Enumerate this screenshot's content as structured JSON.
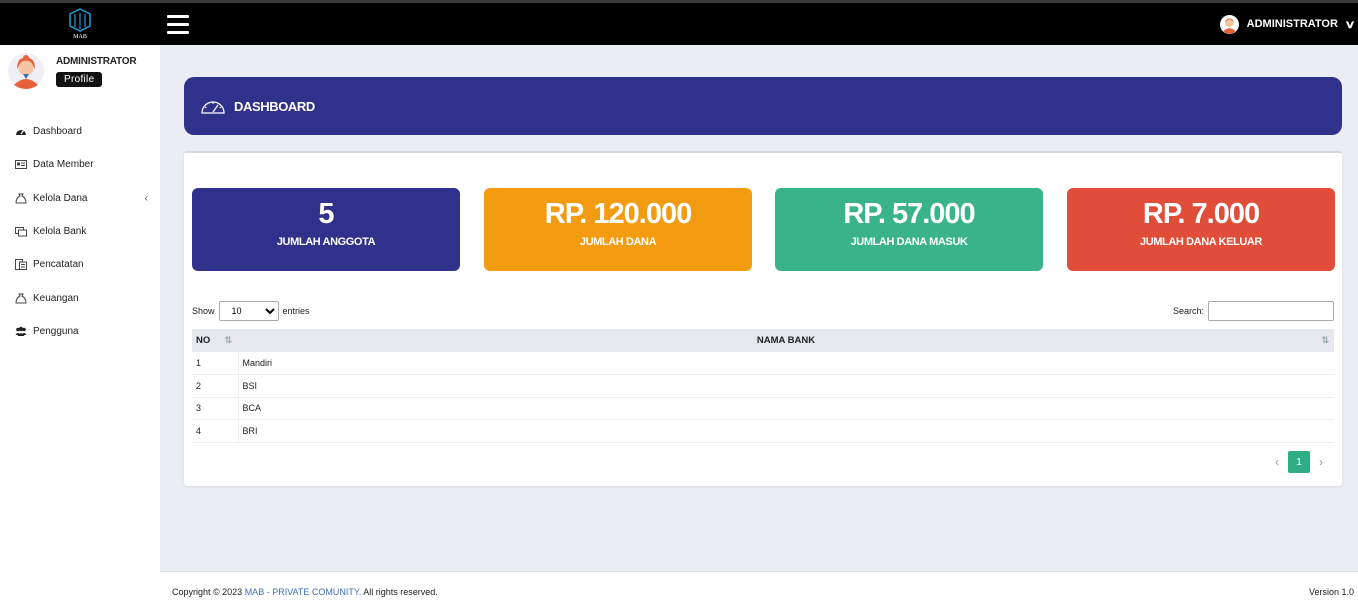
{
  "header": {
    "logo_text": "MAB",
    "user_name": "ADMINISTRATOR"
  },
  "sidebar": {
    "user_name": "ADMINISTRATOR",
    "profile_label": "Profile",
    "items": [
      {
        "label": "Dashboard",
        "icon": "tachometer-icon"
      },
      {
        "label": "Data Member",
        "icon": "id-card-icon"
      },
      {
        "label": "Kelola Dana",
        "icon": "money-bag-icon",
        "arrow": "‹"
      },
      {
        "label": "Kelola Bank",
        "icon": "bank-transfer-icon"
      },
      {
        "label": "Pencatatan",
        "icon": "ledger-icon"
      },
      {
        "label": "Keuangan",
        "icon": "finance-icon"
      },
      {
        "label": "Pengguna",
        "icon": "users-icon"
      }
    ]
  },
  "main": {
    "title": "DASHBOARD",
    "stats": [
      {
        "value": "5",
        "label": "JUMLAH ANGGOTA",
        "color": "#30318b"
      },
      {
        "value": "RP. 120.000",
        "label": "JUMLAH DANA",
        "color": "#f39c12"
      },
      {
        "value": "RP. 57.000",
        "label": "JUMLAH DANA MASUK",
        "color": "#3bb38a"
      },
      {
        "value": "RP. 7.000",
        "label": "JUMLAH DANA KELUAR",
        "color": "#e04e39"
      }
    ],
    "table": {
      "show_label": "Show",
      "entries_label": "entries",
      "page_length": "10",
      "search_label": "Search:",
      "columns": [
        "NO",
        "NAMA BANK"
      ],
      "rows": [
        {
          "no": "1",
          "name": "Mandiri"
        },
        {
          "no": "2",
          "name": "BSI"
        },
        {
          "no": "3",
          "name": "BCA"
        },
        {
          "no": "4",
          "name": "BRI"
        }
      ],
      "pagination": {
        "prev": "‹",
        "current": "1",
        "next": "›"
      }
    }
  },
  "footer": {
    "copyright_prefix": "Copyright © 2023 ",
    "brand": "MAB - PRIVATE COMUNITY.",
    "suffix": " All rights reserved.",
    "version": "Version 1.0"
  },
  "colors": {
    "topbar": "#000000",
    "header_bg": "#30318b",
    "accent_green": "#2fae86",
    "link": "#3d6eb5"
  }
}
